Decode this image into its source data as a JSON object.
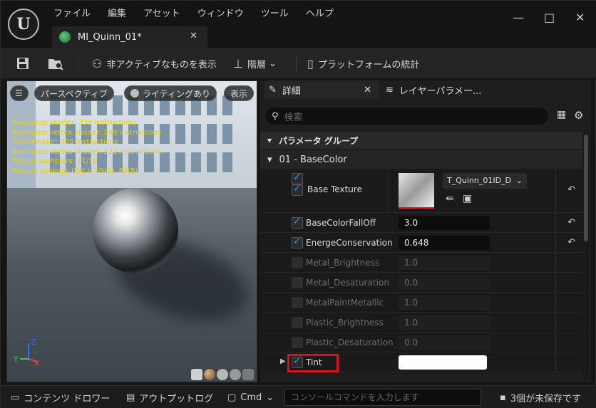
{
  "menu": [
    "ファイル",
    "編集",
    "アセット",
    "ウィンドウ",
    "ツール",
    "ヘルプ"
  ],
  "doc_tab": {
    "label": "MI_Quinn_01*"
  },
  "window_controls": {
    "minimize": "—",
    "maximize": "□",
    "close": "✕"
  },
  "toolbar": {
    "show_inactive": "非アクティブなものを表示",
    "hierarchy": "階層",
    "platform_stats": "プラットフォームの統計"
  },
  "viewport": {
    "perspective": "パースペクティブ",
    "lighting": "ライティングあり",
    "show": "表示",
    "stats": [
      "Base pass shader: 339 instructions",
      "Base pass vertex shader: 249 instructions",
      "MaxSampler: 405 instructions",
      "Base pass vertex shader: 522 instructions",
      "Texture samplers: 11/16",
      "Texture Lookups (Est.): VS(3), PS(8)"
    ],
    "axis_x": "X",
    "axis_y": "Y",
    "axis_z": "Z"
  },
  "panel": {
    "tab_details": "詳細",
    "tab_layers": "レイヤーパラメー...",
    "search_placeholder": "検索",
    "group_header": "パラメータ グループ",
    "section": "01 - BaseColor",
    "texture_name": "T_Quinn_01ID_D",
    "rows": [
      {
        "label": "Base Texture",
        "checked": true
      },
      {
        "label": "BaseColorFallOff",
        "checked": true,
        "value": "3.0"
      },
      {
        "label": "EnergeConservation",
        "checked": true,
        "value": "0.648"
      },
      {
        "label": "Metal_Brightness",
        "checked": false,
        "value": "1.0"
      },
      {
        "label": "Metal_Desaturation",
        "checked": false,
        "value": "0.0"
      },
      {
        "label": "MetalPaintMetallic",
        "checked": false,
        "value": "1.0"
      },
      {
        "label": "Plastic_Brightness",
        "checked": false,
        "value": "1.0"
      },
      {
        "label": "Plastic_Desaturation",
        "checked": false,
        "value": "0.0"
      },
      {
        "label": "Tint",
        "checked": true,
        "value": ""
      }
    ]
  },
  "statusbar": {
    "content_drawer": "コンテンツ ドロワー",
    "output_log": "アウトプットログ",
    "cmd": "Cmd",
    "console_placeholder": "コンソールコマンドを入力します",
    "unsaved": "3個が未保存です"
  },
  "colors": {
    "accent": "#2f8ff0",
    "highlight": "#e0101a",
    "stats_text": "#e6d200"
  }
}
